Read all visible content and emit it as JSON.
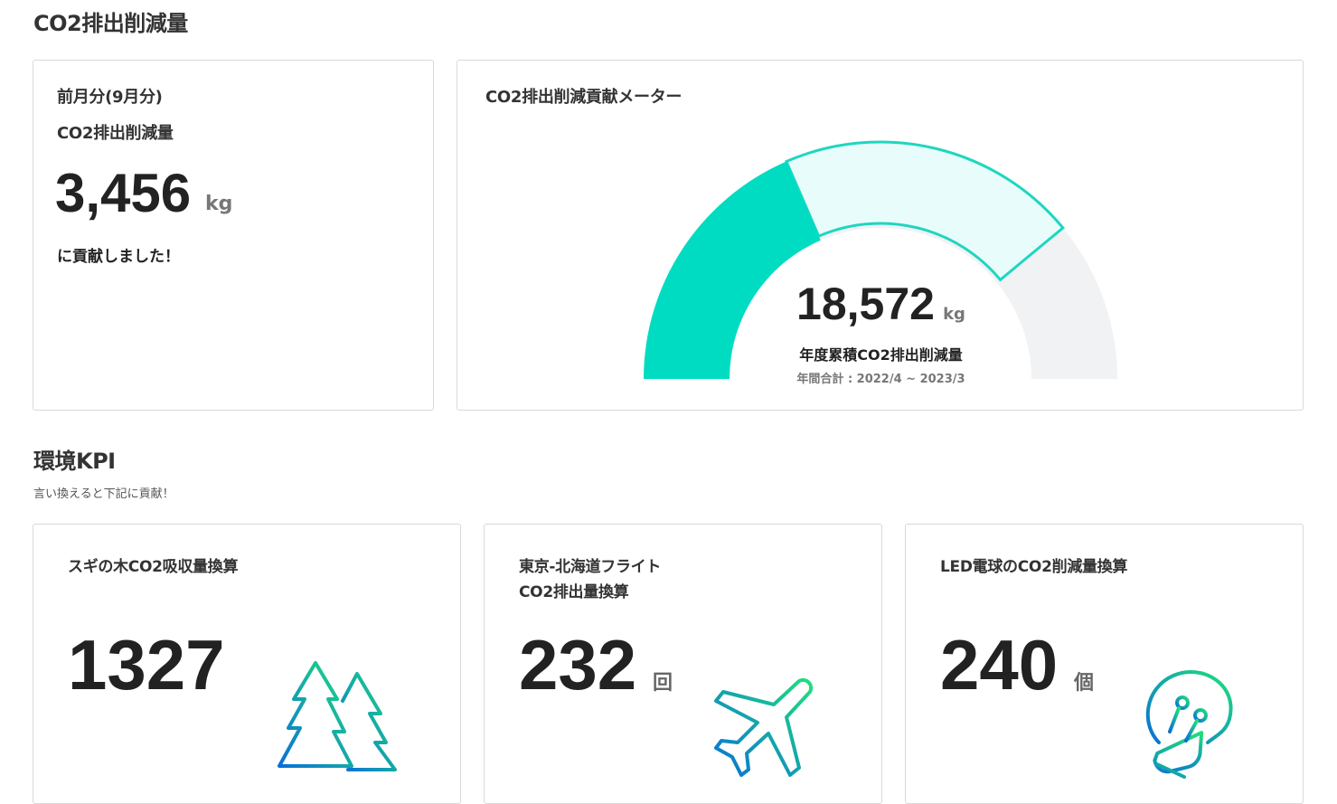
{
  "co2_section": {
    "title": "CO2排出削減量",
    "monthly_card": {
      "label_line1": "前月分(9月分)",
      "label_line2": "CO2排出削減量",
      "value": "3,456",
      "unit": "kg",
      "caption": "に貢献しました！"
    },
    "meter_card": {
      "title": "CO2排出削減貢献メーター",
      "value": "18,572",
      "unit": "kg",
      "caption": "年度累積CO2排出削減量",
      "period": "年間合計 : 2022/4 ~ 2023/3",
      "achieved_fraction": 0.37,
      "highlighted_fraction": 0.78,
      "colors": {
        "filled": "#00dcc2",
        "highlight_fill": "#e8fdfb",
        "highlight_stroke": "#1fd6c0",
        "remaining": "#f1f2f4"
      }
    }
  },
  "kpi_section": {
    "title": "環境KPI",
    "subtitle": "言い換えると下記に貢献！",
    "cards": [
      {
        "label_line1": "スギの木CO2吸収量換算",
        "label_line2": "",
        "value": "1327",
        "unit": "",
        "icon": "tree-icon"
      },
      {
        "label_line1": "東京-北海道フライト",
        "label_line2": "CO2排出量換算",
        "value": "232",
        "unit": "回",
        "icon": "airplane-icon"
      },
      {
        "label_line1": "LED電球のCO2削減量換算",
        "label_line2": "",
        "value": "240",
        "unit": "個",
        "icon": "lightbulb-icon"
      }
    ]
  },
  "colors": {
    "icon_gradient_start": "#1fe07a",
    "icon_gradient_end": "#0a6fd8"
  }
}
